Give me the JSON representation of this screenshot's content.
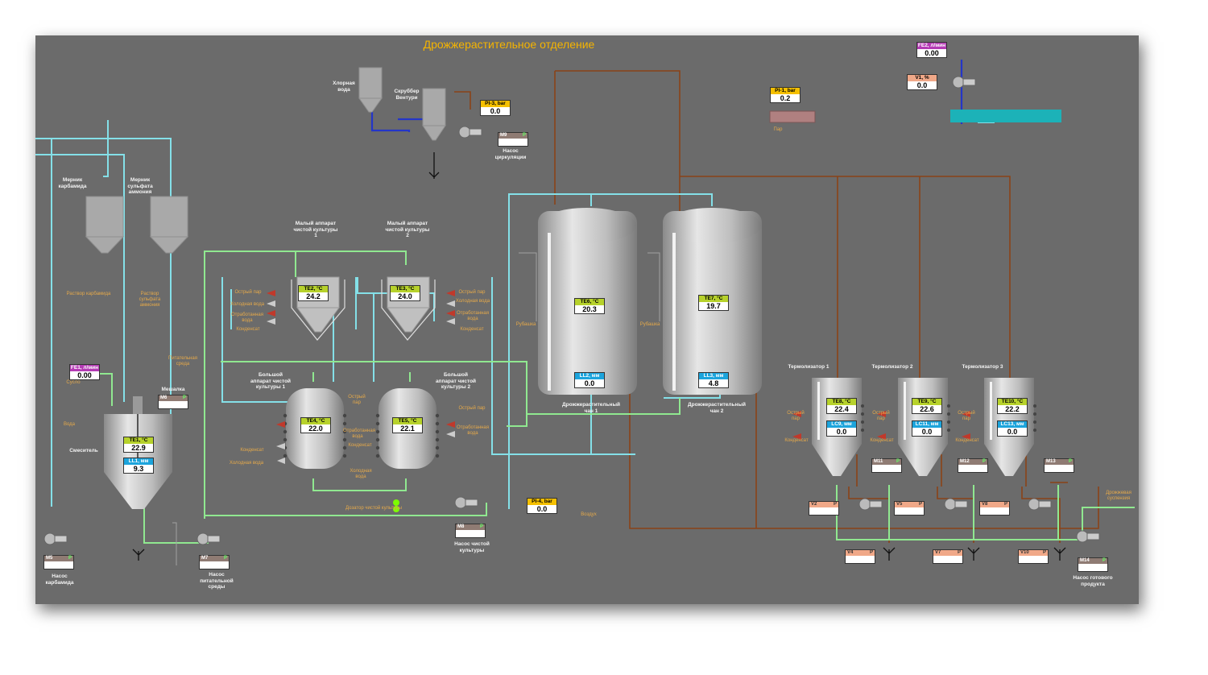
{
  "title": "Дрожжерастительное отделение",
  "colors": {
    "panel": "#6b6b6b",
    "steam_pipe": "#8a4318",
    "cool_pipe": "#84e0e8",
    "green_pipe": "#90e890",
    "water_pipe": "#2436c8",
    "title": "#f5b400"
  },
  "labels": {
    "chlorine_water": "Хлорная вода",
    "scrubber": "Скруббер Вентури",
    "circ_pump": "Насос циркуляции",
    "carbamide_meter": "Мерник карбамида",
    "sulfate_meter": "Мерник сульфата аммония",
    "carbamide_solution": "Раствор карбамида",
    "sulfate_solution": "Раствор сульфата аммония",
    "small_app_1": "Малый аппарат чистой культуры 1",
    "small_app_2": "Малый аппарат чистой культуры 2",
    "big_app_1": "Большой аппарат чистой культуры 1",
    "big_app_2": "Большой аппарат чистой культуры 2",
    "mixer_word": "Мешалка",
    "mixer": "Смеситель",
    "nutrient_medium": "Питательная среда",
    "sugar": "Сусло",
    "water": "Вода",
    "carbamide_pump": "Насос карбамида",
    "nutrient_pump": "Насос питательной среды",
    "culture_pump": "Насос чистой культуры",
    "vat1": "Дрожжерастительный чан 1",
    "vat2": "Дрожжерастительный чан 2",
    "jacket": "Рубашка",
    "air": "Воздух",
    "culture_dosing": "Дозатор чистой культуры",
    "steam": "Пар",
    "thermolizer1": "Термолизатор 1",
    "thermolizer2": "Термолизатор 2",
    "thermolizer3": "Термолизатор 3",
    "sharp_steam": "Острый пар",
    "condensate": "Конденсат",
    "cold_water": "Холодная вода",
    "waste_water": "Отработанная вода",
    "yeast_suspension": "Дрожжевая суспензия",
    "product_pump": "Насос готового продукта"
  },
  "tags": {
    "te2": {
      "name": "TE2, °C",
      "value": "24.2"
    },
    "te3": {
      "name": "TE3, °C",
      "value": "24.0"
    },
    "te4": {
      "name": "TE4, °C",
      "value": "22.0"
    },
    "te5": {
      "name": "TE5, °C",
      "value": "22.1"
    },
    "te1": {
      "name": "TE1, °C",
      "value": "22.9"
    },
    "lt1": {
      "name": "LL1, мм",
      "value": "9.3"
    },
    "te6": {
      "name": "TE6, °C",
      "value": "20.3"
    },
    "lt2": {
      "name": "LL2, мм",
      "value": "0.0"
    },
    "te7": {
      "name": "TE7, °C",
      "value": "19.7"
    },
    "lt3": {
      "name": "LL3, мм",
      "value": "4.8"
    },
    "te8": {
      "name": "TE8, °C",
      "value": "22.4"
    },
    "lc9": {
      "name": "LC9, мм",
      "value": "0.0"
    },
    "te9": {
      "name": "TE9, °C",
      "value": "22.6"
    },
    "lc11": {
      "name": "LC11, мм",
      "value": "0.0"
    },
    "te10": {
      "name": "TE10, °C",
      "value": "22.2"
    },
    "lc13": {
      "name": "LC13, мм",
      "value": "0.0"
    },
    "pi3": {
      "name": "PI-3, bar",
      "value": "0.0"
    },
    "pi4": {
      "name": "PI-4, bar",
      "value": "0.0"
    },
    "pi1": {
      "name": "PI-1, bar",
      "value": "0.2"
    },
    "fe1": {
      "name": "FE1, л/мин",
      "value": "0.00"
    },
    "fe2": {
      "name": "FE2, л/мин",
      "value": "0.00"
    },
    "v1": {
      "name": "V1, %",
      "value": "0.0"
    }
  },
  "motors": {
    "m9": "M9",
    "m6": "M6",
    "m5": "M5",
    "m7": "M7",
    "m8": "M8",
    "m11": "M11",
    "m12": "M12",
    "m13": "M13",
    "m14": "M14"
  },
  "valves": {
    "v2": "V2",
    "v5": "V5",
    "v8": "V8",
    "v4": "V4",
    "v7": "V7",
    "v10": "V10"
  },
  "indicator": "P"
}
